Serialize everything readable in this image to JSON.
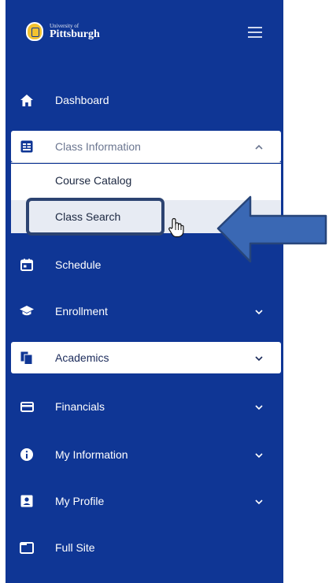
{
  "header": {
    "logo_small": "University of",
    "logo_big": "Pittsburgh"
  },
  "nav": {
    "dashboard": "Dashboard",
    "class_information": "Class Information",
    "submenu": {
      "course_catalog": "Course Catalog",
      "class_search": "Class Search"
    },
    "schedule": "Schedule",
    "enrollment": "Enrollment",
    "academics": "Academics",
    "financials": "Financials",
    "my_information": "My Information",
    "my_profile": "My Profile",
    "full_site": "Full Site"
  },
  "colors": {
    "sidebar": "#0f3695",
    "arrow": "#3a68b4",
    "outline": "#2c4371",
    "gold": "#f2c230"
  },
  "icons": [
    "home-icon",
    "id-card-icon",
    "calendar-icon",
    "graduation-cap-icon",
    "documents-icon",
    "credit-card-icon",
    "info-icon",
    "profile-card-icon",
    "window-icon",
    "chevron-down-icon",
    "chevron-up-icon",
    "hamburger-icon",
    "hand-cursor-icon"
  ]
}
